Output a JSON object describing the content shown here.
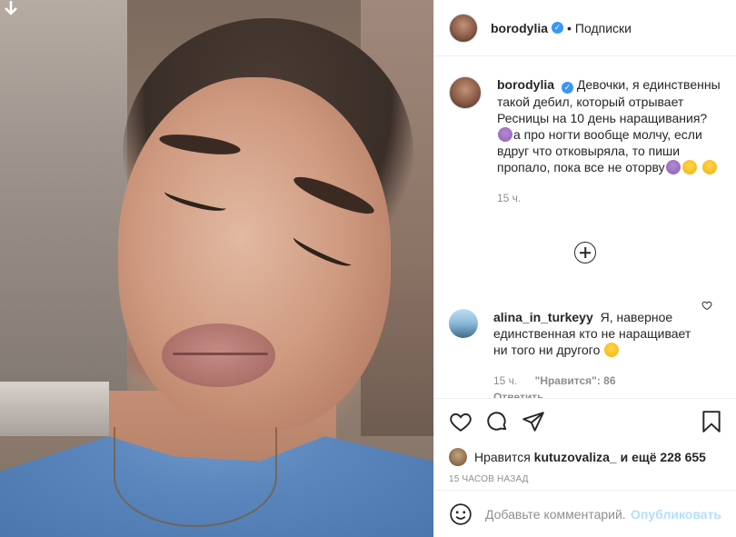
{
  "post": {
    "author": "borodylia",
    "follow_label": "Подписки",
    "separator": "•"
  },
  "caption": {
    "author": "borodylia",
    "text_part1": "Девочки, я единственны такой дебил, который отрывает Ресницы на 10 день наращивания?",
    "text_part2": "а про ногти вообще молчу, если вдруг что отковыряла, то пиши пропало, пока все не оторву",
    "time": "15 ч."
  },
  "reply": {
    "author": "alina_in_turkeyy",
    "text": "Я, наверное единственная кто не наращивает ни того ни другого",
    "time": "15 ч.",
    "likes": "\"Нравится\": 86",
    "reply_label": "Ответить"
  },
  "likes": {
    "prefix": "Нравится",
    "user": "kutuzovaliza_",
    "suffix": "и ещё 228 655"
  },
  "timestamp": "15 ЧАСОВ НАЗАД",
  "add_comment": {
    "placeholder": "Добавьте комментарий...",
    "publish_label": "Опубликовать"
  },
  "icons": {
    "like": "heart-icon",
    "comment": "comment-icon",
    "share": "paper-plane-icon",
    "save": "bookmark-icon",
    "emoji": "smiley-icon",
    "load_more": "plus-circle-icon",
    "verified": "verified-badge-icon",
    "download": "down-arrow-icon"
  },
  "colors": {
    "verified": "#3897f0",
    "publish_disabled": "#b2dffc",
    "secondary_text": "#8e8e8e"
  }
}
